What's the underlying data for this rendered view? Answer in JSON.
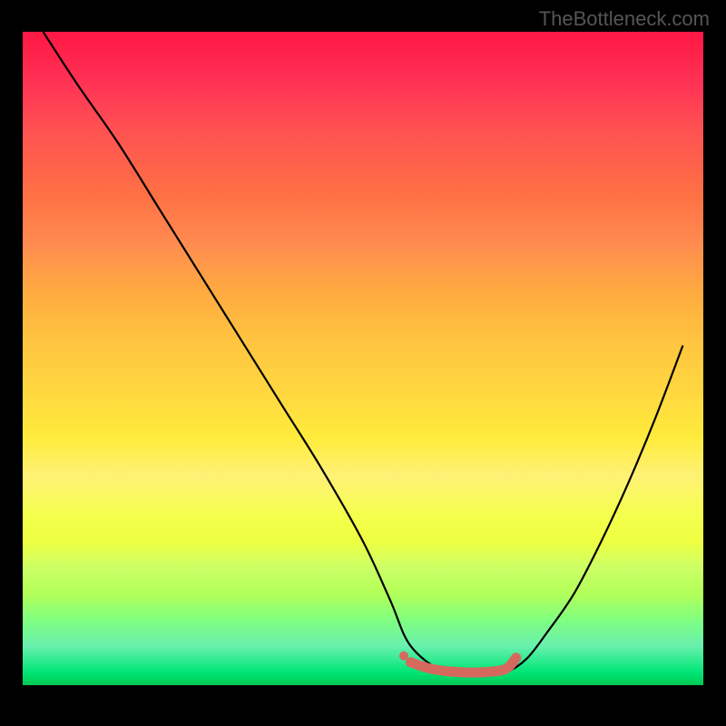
{
  "watermark": "TheBottleneck.com",
  "chart_data": {
    "type": "line",
    "title": "",
    "xlabel": "",
    "ylabel": "",
    "xlim": [
      0,
      100
    ],
    "ylim": [
      0,
      100
    ],
    "series": [
      {
        "name": "main-curve",
        "x": [
          3,
          8,
          14,
          20,
          26,
          32,
          38,
          44,
          50,
          54,
          57,
          62,
          67,
          71,
          74,
          77,
          81,
          85,
          89,
          93,
          97
        ],
        "values": [
          100,
          92,
          83,
          73,
          63,
          53,
          43,
          33,
          22,
          13,
          6,
          2,
          1.5,
          2,
          4,
          8,
          14,
          22,
          31,
          41,
          52
        ]
      },
      {
        "name": "highlight-segment",
        "x": [
          57,
          60,
          64,
          68,
          71,
          72.5
        ],
        "values": [
          3.5,
          2.5,
          2,
          2,
          2.5,
          4.2
        ]
      }
    ],
    "highlight_dot": {
      "x": 56,
      "y": 4.5
    },
    "colors": {
      "curve": "#000000",
      "highlight": "#d6695e",
      "gradient_top": "#ff1744",
      "gradient_bottom": "#00c853"
    }
  }
}
